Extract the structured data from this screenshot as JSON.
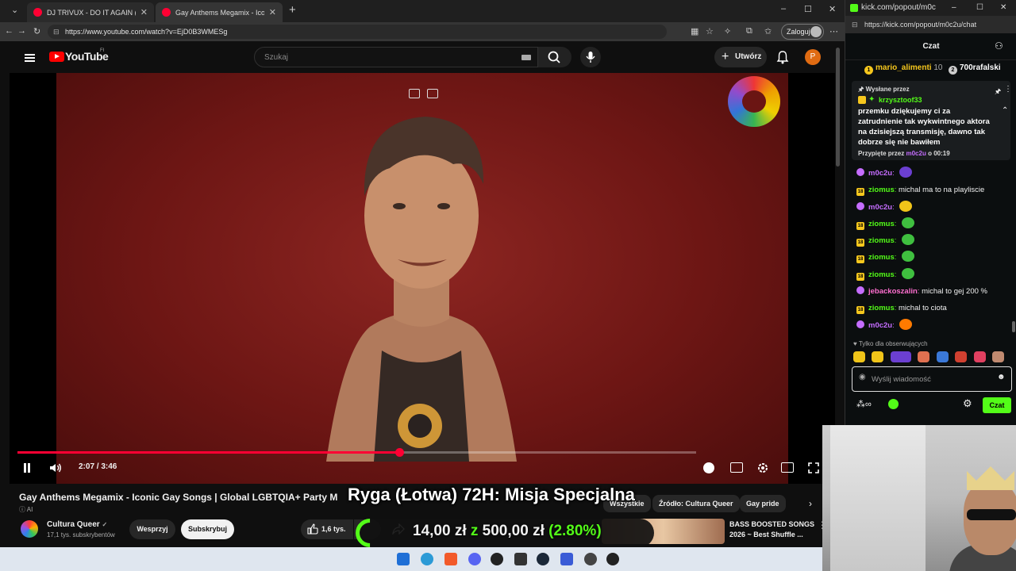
{
  "browser": {
    "tabs": [
      {
        "title": "DJ TRIVUX - DO IT AGAIN (Gangst"
      },
      {
        "title": "Gay Anthems Megamix - Icon"
      }
    ],
    "url": "https://www.youtube.com/watch?v=EjD0B3WMESg",
    "sign_in": "Zaloguj"
  },
  "youtube": {
    "logo_text": "YouTube",
    "logo_region": "FI",
    "search_placeholder": "Szukaj",
    "create_label": "Utwórz",
    "avatar_letter": "P",
    "player": {
      "current_time": "2:07",
      "duration": "3:46",
      "time_display": "2:07 / 3:46",
      "progress_fraction": 0.562
    },
    "video_title": "Gay Anthems Megamix - Iconic Gay Songs | Global LGBTQIA+ Party M",
    "ai_label": "AI",
    "channel": {
      "name": "Cultura Queer",
      "subscribers": "17,1 tys. subskrybentów"
    },
    "support_label": "Wesprzyj",
    "subscribe_label": "Subskrybuj",
    "likes": "1,6 tys.",
    "chips": [
      "Wszystkie",
      "Źródło: Cultura Queer",
      "Gay pride"
    ],
    "recommended": {
      "title": "BASS BOOSTED SONGS 2026 ~ Best Shuffle ..."
    }
  },
  "stream_overlay": {
    "banner": "Ryga (Łotwa) 72H: Misja Specjalna",
    "donation_current": "14,00 zł",
    "donation_separator": "z",
    "donation_goal": "500,00 zł",
    "donation_percent": "(2.80%)",
    "donation_fraction": 0.028,
    "accent_color": "#53fc18"
  },
  "kick": {
    "window_title": "kick.com/popout/m0c",
    "url": "https://kick.com/popout/m0c2u/chat",
    "chat_title": "Czat",
    "leaderboard": [
      {
        "name": "mario_alimenti",
        "count": "10"
      },
      {
        "name": "700rafalski",
        "count": ""
      }
    ],
    "pinned": {
      "label": "Wysłane przez",
      "user": "krzysztoof33",
      "message": "przemku dziękujemy ci za zatrudnienie tak wykwintnego aktora na dzisiejszą transmisję, dawno tak dobrze się nie bawiłem",
      "pinned_by_label": "Przypięte przez",
      "pinned_by_user": "m0c2u",
      "pinned_time": "o 00:19"
    },
    "messages": [
      {
        "user": "m0c2u",
        "badge": "mod",
        "color": "#c56dff",
        "text": "",
        "emote": "#6b3fd1"
      },
      {
        "user": "ziomus",
        "badge": "18",
        "color": "#53fc18",
        "text": "michal ma to na playliscie",
        "emote": ""
      },
      {
        "user": "m0c2u",
        "badge": "mod",
        "color": "#c56dff",
        "text": "",
        "emote": "#f0c419"
      },
      {
        "user": "ziomus",
        "badge": "18",
        "color": "#53fc18",
        "text": "",
        "emote": "#3fbf3f"
      },
      {
        "user": "ziomus",
        "badge": "18",
        "color": "#53fc18",
        "text": "",
        "emote": "#3fbf3f"
      },
      {
        "user": "ziomus",
        "badge": "18",
        "color": "#53fc18",
        "text": "",
        "emote": "#3fbf3f"
      },
      {
        "user": "ziomus",
        "badge": "18",
        "color": "#53fc18",
        "text": "",
        "emote": "#3fbf3f"
      },
      {
        "user": "jebackoszalin",
        "badge": "mod",
        "color": "#ff6fd0",
        "text": "michal to gej 200 %",
        "emote": ""
      },
      {
        "user": "ziomus",
        "badge": "18",
        "color": "#53fc18",
        "text": "michal to ciota",
        "emote": ""
      },
      {
        "user": "m0c2u",
        "badge": "mod",
        "color": "#c56dff",
        "text": "",
        "emote": "#ff7a00"
      }
    ],
    "followers_only": "Tylko dla obserwujących",
    "input_placeholder": "Wyślij wiadomość",
    "send_label": "Czat"
  }
}
